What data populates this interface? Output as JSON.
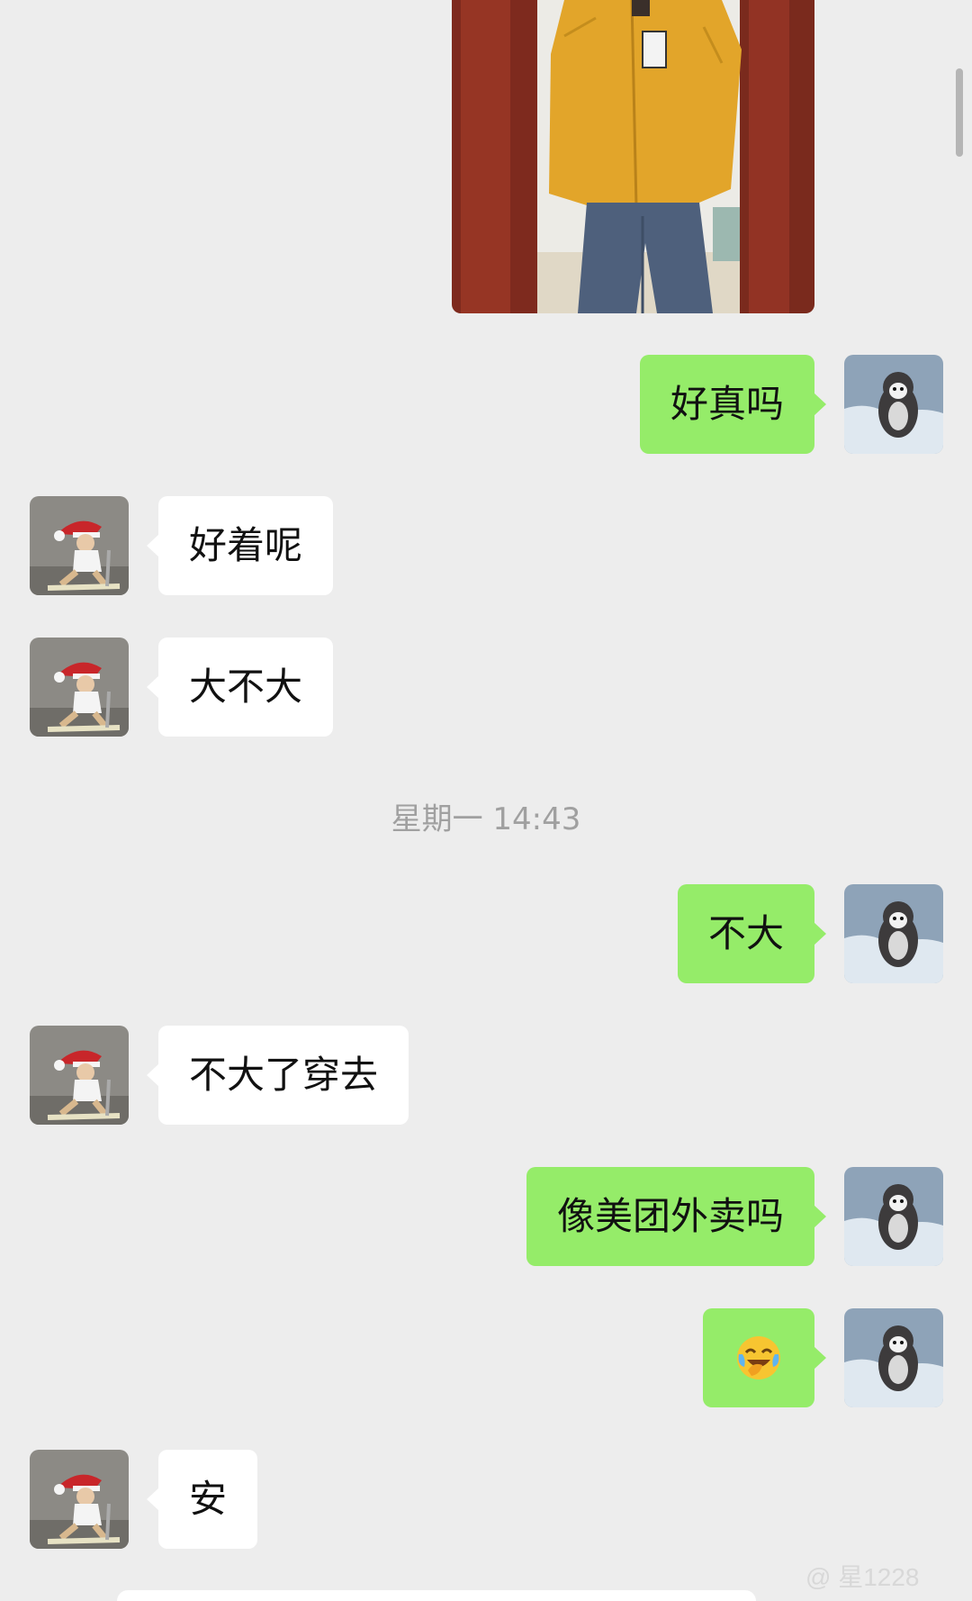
{
  "messages": [
    {
      "side": "me",
      "text": "好真吗"
    },
    {
      "side": "other",
      "text": "好着呢"
    },
    {
      "side": "other",
      "text": "大不大"
    },
    {
      "side": "me",
      "text": "不大"
    },
    {
      "side": "other",
      "text": "不大了穿去"
    },
    {
      "side": "me",
      "text": "像美团外卖吗"
    },
    {
      "side": "me",
      "emoji": "face-with-tears-of-joy"
    },
    {
      "side": "other",
      "text": "安"
    }
  ],
  "timestamp": "星期一 14:43",
  "watermark": "@ 星1228",
  "colors": {
    "background": "#ededed",
    "my_bubble": "#95ec69",
    "their_bubble": "#ffffff",
    "timestamp_text": "#a0a0a0"
  },
  "icons": {
    "my_avatar": "penguin-avatar-icon",
    "their_avatar": "santa-hat-kid-avatar-icon",
    "emoji": "face-with-tears-of-joy-icon"
  }
}
